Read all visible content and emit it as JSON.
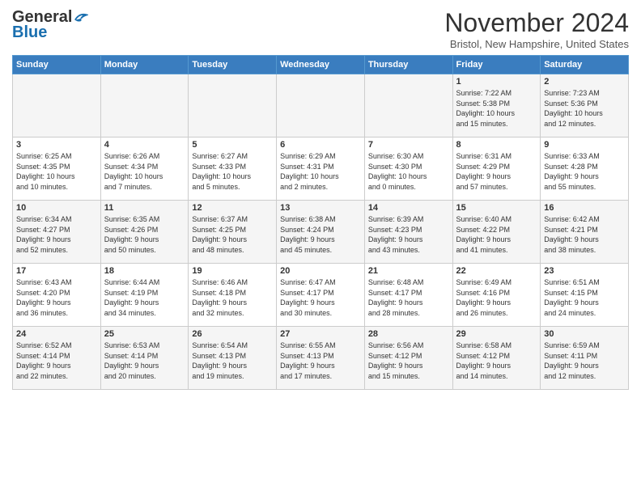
{
  "logo": {
    "general": "General",
    "blue": "Blue"
  },
  "title": "November 2024",
  "location": "Bristol, New Hampshire, United States",
  "days_header": [
    "Sunday",
    "Monday",
    "Tuesday",
    "Wednesday",
    "Thursday",
    "Friday",
    "Saturday"
  ],
  "weeks": [
    [
      {
        "day": "",
        "info": ""
      },
      {
        "day": "",
        "info": ""
      },
      {
        "day": "",
        "info": ""
      },
      {
        "day": "",
        "info": ""
      },
      {
        "day": "",
        "info": ""
      },
      {
        "day": "1",
        "info": "Sunrise: 7:22 AM\nSunset: 5:38 PM\nDaylight: 10 hours\nand 15 minutes."
      },
      {
        "day": "2",
        "info": "Sunrise: 7:23 AM\nSunset: 5:36 PM\nDaylight: 10 hours\nand 12 minutes."
      }
    ],
    [
      {
        "day": "3",
        "info": "Sunrise: 6:25 AM\nSunset: 4:35 PM\nDaylight: 10 hours\nand 10 minutes."
      },
      {
        "day": "4",
        "info": "Sunrise: 6:26 AM\nSunset: 4:34 PM\nDaylight: 10 hours\nand 7 minutes."
      },
      {
        "day": "5",
        "info": "Sunrise: 6:27 AM\nSunset: 4:33 PM\nDaylight: 10 hours\nand 5 minutes."
      },
      {
        "day": "6",
        "info": "Sunrise: 6:29 AM\nSunset: 4:31 PM\nDaylight: 10 hours\nand 2 minutes."
      },
      {
        "day": "7",
        "info": "Sunrise: 6:30 AM\nSunset: 4:30 PM\nDaylight: 10 hours\nand 0 minutes."
      },
      {
        "day": "8",
        "info": "Sunrise: 6:31 AM\nSunset: 4:29 PM\nDaylight: 9 hours\nand 57 minutes."
      },
      {
        "day": "9",
        "info": "Sunrise: 6:33 AM\nSunset: 4:28 PM\nDaylight: 9 hours\nand 55 minutes."
      }
    ],
    [
      {
        "day": "10",
        "info": "Sunrise: 6:34 AM\nSunset: 4:27 PM\nDaylight: 9 hours\nand 52 minutes."
      },
      {
        "day": "11",
        "info": "Sunrise: 6:35 AM\nSunset: 4:26 PM\nDaylight: 9 hours\nand 50 minutes."
      },
      {
        "day": "12",
        "info": "Sunrise: 6:37 AM\nSunset: 4:25 PM\nDaylight: 9 hours\nand 48 minutes."
      },
      {
        "day": "13",
        "info": "Sunrise: 6:38 AM\nSunset: 4:24 PM\nDaylight: 9 hours\nand 45 minutes."
      },
      {
        "day": "14",
        "info": "Sunrise: 6:39 AM\nSunset: 4:23 PM\nDaylight: 9 hours\nand 43 minutes."
      },
      {
        "day": "15",
        "info": "Sunrise: 6:40 AM\nSunset: 4:22 PM\nDaylight: 9 hours\nand 41 minutes."
      },
      {
        "day": "16",
        "info": "Sunrise: 6:42 AM\nSunset: 4:21 PM\nDaylight: 9 hours\nand 38 minutes."
      }
    ],
    [
      {
        "day": "17",
        "info": "Sunrise: 6:43 AM\nSunset: 4:20 PM\nDaylight: 9 hours\nand 36 minutes."
      },
      {
        "day": "18",
        "info": "Sunrise: 6:44 AM\nSunset: 4:19 PM\nDaylight: 9 hours\nand 34 minutes."
      },
      {
        "day": "19",
        "info": "Sunrise: 6:46 AM\nSunset: 4:18 PM\nDaylight: 9 hours\nand 32 minutes."
      },
      {
        "day": "20",
        "info": "Sunrise: 6:47 AM\nSunset: 4:17 PM\nDaylight: 9 hours\nand 30 minutes."
      },
      {
        "day": "21",
        "info": "Sunrise: 6:48 AM\nSunset: 4:17 PM\nDaylight: 9 hours\nand 28 minutes."
      },
      {
        "day": "22",
        "info": "Sunrise: 6:49 AM\nSunset: 4:16 PM\nDaylight: 9 hours\nand 26 minutes."
      },
      {
        "day": "23",
        "info": "Sunrise: 6:51 AM\nSunset: 4:15 PM\nDaylight: 9 hours\nand 24 minutes."
      }
    ],
    [
      {
        "day": "24",
        "info": "Sunrise: 6:52 AM\nSunset: 4:14 PM\nDaylight: 9 hours\nand 22 minutes."
      },
      {
        "day": "25",
        "info": "Sunrise: 6:53 AM\nSunset: 4:14 PM\nDaylight: 9 hours\nand 20 minutes."
      },
      {
        "day": "26",
        "info": "Sunrise: 6:54 AM\nSunset: 4:13 PM\nDaylight: 9 hours\nand 19 minutes."
      },
      {
        "day": "27",
        "info": "Sunrise: 6:55 AM\nSunset: 4:13 PM\nDaylight: 9 hours\nand 17 minutes."
      },
      {
        "day": "28",
        "info": "Sunrise: 6:56 AM\nSunset: 4:12 PM\nDaylight: 9 hours\nand 15 minutes."
      },
      {
        "day": "29",
        "info": "Sunrise: 6:58 AM\nSunset: 4:12 PM\nDaylight: 9 hours\nand 14 minutes."
      },
      {
        "day": "30",
        "info": "Sunrise: 6:59 AM\nSunset: 4:11 PM\nDaylight: 9 hours\nand 12 minutes."
      }
    ]
  ]
}
